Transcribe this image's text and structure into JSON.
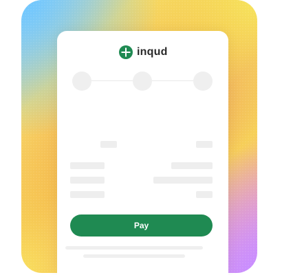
{
  "brand": {
    "name": "inqud",
    "icon": "inqud-logo-icon",
    "color": "#1f8a52"
  },
  "stepper": {
    "steps": 3,
    "current": null
  },
  "payment": {
    "pay_label": "Pay",
    "button_color": "#1f8a52"
  },
  "colors": {
    "frame_gradient": [
      "#6ec6ff",
      "#f8d868",
      "#f2a848",
      "#ef9a5c",
      "#f3a8b0",
      "#d79cff"
    ],
    "placeholder": "#eeeeee"
  }
}
